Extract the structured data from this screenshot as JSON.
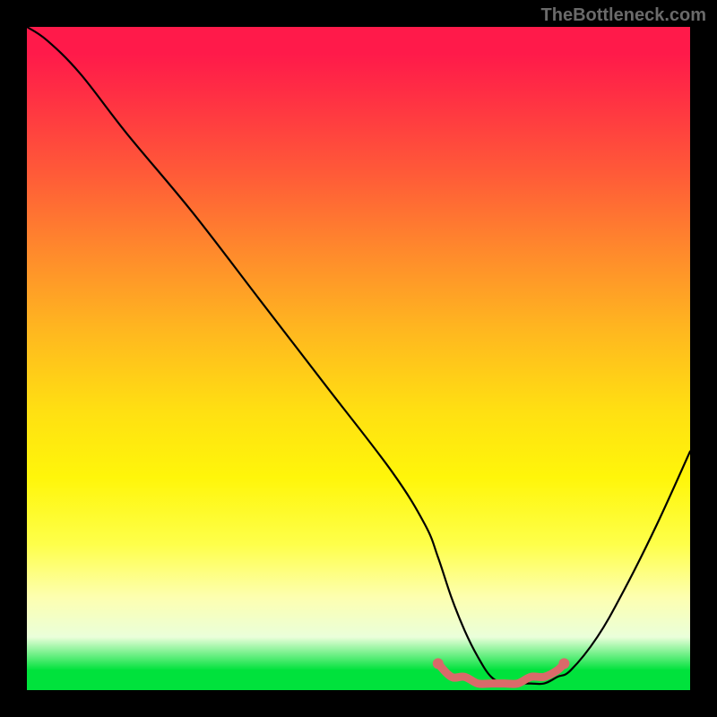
{
  "watermark": "TheBottleneck.com",
  "chart_data": {
    "type": "line",
    "title": "",
    "xlabel": "",
    "ylabel": "",
    "xlim": [
      0,
      100
    ],
    "ylim": [
      0,
      100
    ],
    "grid": false,
    "series": [
      {
        "name": "bottleneck-curve",
        "x": [
          0,
          3,
          8,
          15,
          25,
          35,
          45,
          55,
          60,
          62,
          64,
          66,
          68,
          70,
          72,
          74,
          76,
          78,
          80,
          82,
          86,
          90,
          95,
          100
        ],
        "values": [
          100,
          98,
          93,
          84,
          72,
          59,
          46,
          33,
          25,
          20,
          14,
          9,
          5,
          2,
          1,
          1,
          1,
          1,
          2,
          3,
          8,
          15,
          25,
          36
        ],
        "color": "#000000"
      },
      {
        "name": "highlight-bottom",
        "x": [
          62,
          64,
          66,
          68,
          70,
          72,
          74,
          76,
          78,
          80,
          81
        ],
        "values": [
          4,
          2,
          2,
          1,
          1,
          1,
          1,
          2,
          2,
          3,
          4
        ],
        "color": "#d96a6a"
      }
    ],
    "background_gradient": {
      "stops": [
        {
          "pos": 0,
          "color": "#ff1a4a"
        },
        {
          "pos": 22,
          "color": "#ff5a38"
        },
        {
          "pos": 46,
          "color": "#ffb81f"
        },
        {
          "pos": 68,
          "color": "#fff60a"
        },
        {
          "pos": 86,
          "color": "#fdffb0"
        },
        {
          "pos": 97,
          "color": "#00e23c"
        }
      ]
    }
  }
}
